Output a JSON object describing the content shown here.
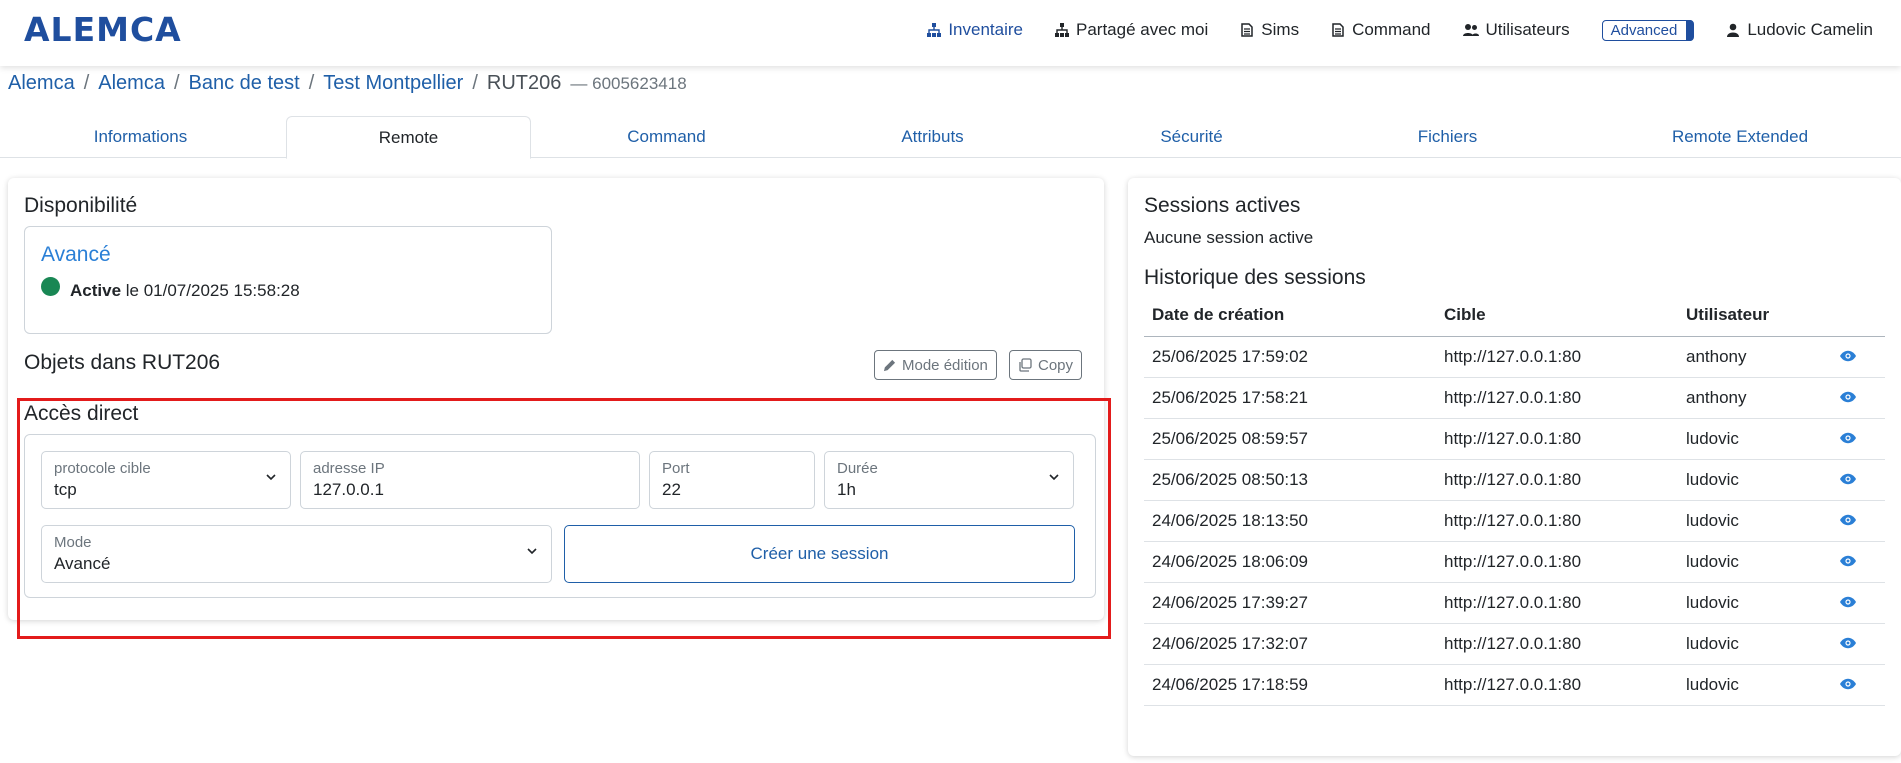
{
  "app": {
    "logo": "ALEMCA"
  },
  "nav": {
    "items": [
      {
        "label": "Inventaire",
        "icon": "sitemap-icon",
        "active": true
      },
      {
        "label": "Partagé avec moi",
        "icon": "sitemap-icon",
        "active": false
      },
      {
        "label": "Sims",
        "icon": "document-icon",
        "active": false
      },
      {
        "label": "Command",
        "icon": "document-icon",
        "active": false
      },
      {
        "label": "Utilisateurs",
        "icon": "users-icon",
        "active": false
      }
    ],
    "badge": "Advanced",
    "user": "Ludovic Camelin"
  },
  "breadcrumb": {
    "items": [
      "Alemca",
      "Alemca",
      "Banc de test",
      "Test Montpellier"
    ],
    "current": "RUT206",
    "serial": "— 6005623418"
  },
  "tabs": [
    "Informations",
    "Remote",
    "Command",
    "Attributs",
    "Sécurité",
    "Fichiers",
    "Remote Extended"
  ],
  "active_tab": "Remote",
  "availability": {
    "title": "Disponibilité",
    "mode": "Avancé",
    "status": "Active",
    "status_suffix": "le 01/07/2025 15:58:28",
    "status_color": "#198754"
  },
  "objects": {
    "title": "Objets dans RUT206",
    "edit_label": "Mode édition",
    "copy_label": "Copy"
  },
  "direct": {
    "title": "Accès direct",
    "protocol": {
      "label": "protocole cible",
      "value": "tcp"
    },
    "ip": {
      "label": "adresse IP",
      "value": "127.0.0.1"
    },
    "port": {
      "label": "Port",
      "value": "22"
    },
    "duration": {
      "label": "Durée",
      "value": "1h"
    },
    "mode": {
      "label": "Mode",
      "value": "Avancé"
    },
    "create_label": "Créer une session"
  },
  "sessions": {
    "active_title": "Sessions actives",
    "none_text": "Aucune session active",
    "history_title": "Historique des sessions",
    "columns": [
      "Date de création",
      "Cible",
      "Utilisateur"
    ],
    "rows": [
      {
        "date": "25/06/2025 17:59:02",
        "target": "http://127.0.0.1:80",
        "user": "anthony"
      },
      {
        "date": "25/06/2025 17:58:21",
        "target": "http://127.0.0.1:80",
        "user": "anthony"
      },
      {
        "date": "25/06/2025 08:59:57",
        "target": "http://127.0.0.1:80",
        "user": "ludovic"
      },
      {
        "date": "25/06/2025 08:50:13",
        "target": "http://127.0.0.1:80",
        "user": "ludovic"
      },
      {
        "date": "24/06/2025 18:13:50",
        "target": "http://127.0.0.1:80",
        "user": "ludovic"
      },
      {
        "date": "24/06/2025 18:06:09",
        "target": "http://127.0.0.1:80",
        "user": "ludovic"
      },
      {
        "date": "24/06/2025 17:39:27",
        "target": "http://127.0.0.1:80",
        "user": "ludovic"
      },
      {
        "date": "24/06/2025 17:32:07",
        "target": "http://127.0.0.1:80",
        "user": "ludovic"
      },
      {
        "date": "24/06/2025 17:18:59",
        "target": "http://127.0.0.1:80",
        "user": "ludovic"
      }
    ]
  },
  "colors": {
    "brand": "#1f4e9e",
    "link": "#1f5fa8",
    "accent": "#2a7fd6",
    "highlight": "#e31b1b"
  }
}
